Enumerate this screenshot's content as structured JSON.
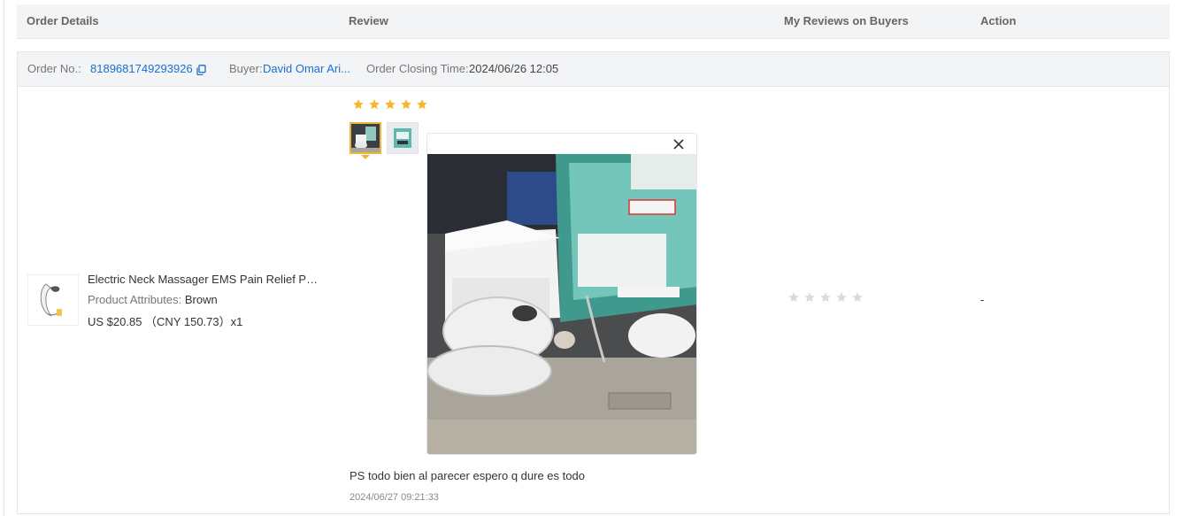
{
  "header": {
    "order_details": "Order Details",
    "review": "Review",
    "my_reviews": "My Reviews on Buyers",
    "action": "Action"
  },
  "order": {
    "number_label": "Order No.:",
    "number": "8189681749293926",
    "buyer_label": "Buyer:",
    "buyer": "David Omar Ari...",
    "closing_label": "Order Closing Time:",
    "closing_time": "2024/06/26 12:05"
  },
  "product": {
    "title": "Electric Neck Massager EMS Pain Relief Pul...",
    "attr_label": "Product Attributes:",
    "attr_value": "Brown",
    "price": "US $20.85 （CNY  150.73）x1"
  },
  "review": {
    "rating": 5,
    "text": "PS todo bien al parecer espero q dure es todo",
    "date": "2024/06/27 09:21:33",
    "thumbnail_count": 2,
    "selected_thumbnail": 1
  },
  "my_review": {
    "rating": 0
  },
  "action": {
    "text": "-"
  },
  "colors": {
    "star_filled": "#f5b731",
    "star_empty": "#dcdcdc",
    "link": "#1a6fd1",
    "selected_border": "#f0b33a"
  }
}
